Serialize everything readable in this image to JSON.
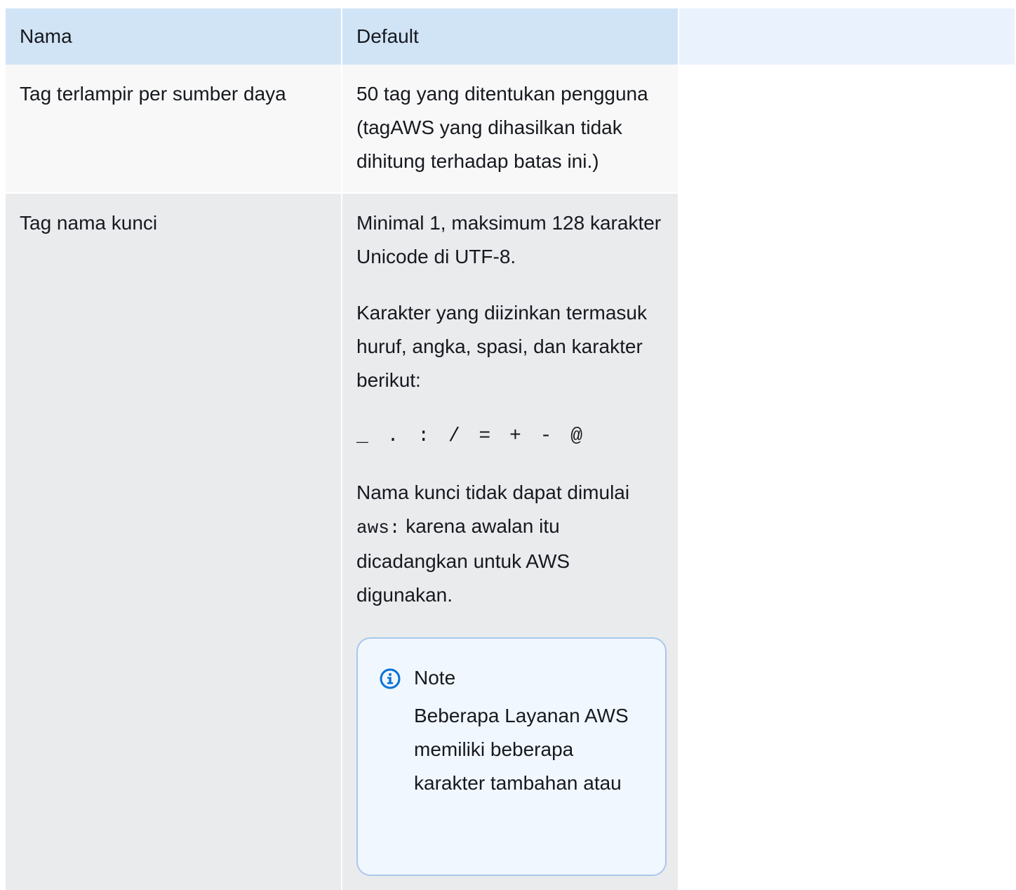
{
  "table": {
    "headers": [
      "Nama",
      "Default",
      ""
    ],
    "rows": [
      {
        "name": "Tag terlampir per sumber daya",
        "default": "50 tag yang ditentukan pengguna (tagAWS yang dihasilkan tidak dihitung terhadap batas ini.)"
      },
      {
        "name": "Tag nama kunci",
        "paragraphs": [
          "Minimal 1, maksimum 128 karakter Unicode di UTF-8.",
          "Karakter yang diizinkan termasuk huruf, angka, spasi, dan karakter berikut:"
        ],
        "allowed_chars": "_ . : / = + - @",
        "prefix_text_before": "Nama kunci tidak dapat dimulai ",
        "prefix_code": "aws:",
        "prefix_text_after": " karena awalan itu dicadangkan untuk AWS digunakan.",
        "note": {
          "icon": "info-icon",
          "title": "Note",
          "body": "Beberapa Layanan AWS memiliki beberapa karakter tambahan atau"
        }
      }
    ]
  },
  "colors": {
    "header_bg": "#d1e4f6",
    "header_extra_bg": "#eaf3fd",
    "row1_bg": "#f8f8f8",
    "row2_bg": "#eaebed",
    "note_border": "#a8c8eb",
    "note_bg": "#f1f7fe",
    "icon_blue": "#0972d3"
  }
}
